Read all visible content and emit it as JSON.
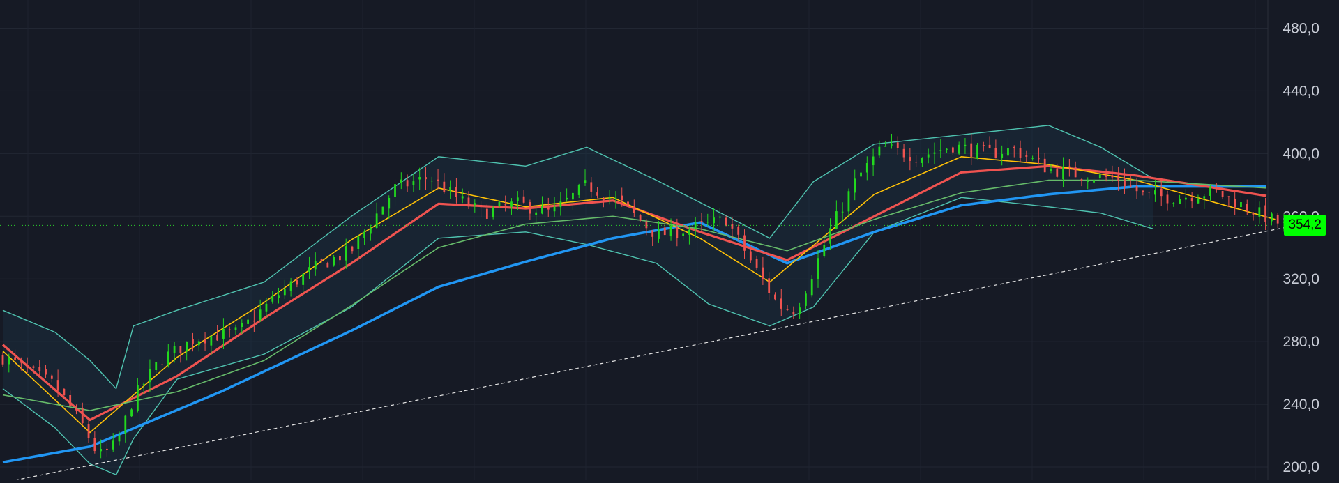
{
  "chart_data": {
    "type": "line",
    "subtype": "candlestick with moving averages and bollinger bands",
    "title": "",
    "xlabel": "",
    "ylabel": "",
    "ylim": [
      192,
      498
    ],
    "y_ticks": [
      200,
      240,
      280,
      320,
      360,
      400,
      440,
      480
    ],
    "y_tick_labels": [
      "200,0",
      "240,0",
      "280,0",
      "320,0",
      "360,0",
      "400,0",
      "440,0",
      "480,0"
    ],
    "grid": true,
    "last_price": 354.2,
    "last_price_label": "354,2",
    "bar_count": 210,
    "price_path": [
      [
        0,
        270
      ],
      [
        12,
        252
      ],
      [
        18,
        228
      ],
      [
        22,
        207
      ],
      [
        26,
        214
      ],
      [
        30,
        244
      ],
      [
        36,
        268
      ],
      [
        44,
        282
      ],
      [
        54,
        286
      ],
      [
        64,
        312
      ],
      [
        72,
        328
      ],
      [
        80,
        338
      ],
      [
        90,
        378
      ],
      [
        98,
        385
      ],
      [
        104,
        372
      ],
      [
        110,
        362
      ],
      [
        118,
        368
      ],
      [
        126,
        362
      ],
      [
        134,
        380
      ],
      [
        142,
        368
      ],
      [
        150,
        348
      ],
      [
        158,
        352
      ],
      [
        166,
        358
      ],
      [
        172,
        330
      ],
      [
        178,
        303
      ],
      [
        182,
        300
      ],
      [
        186,
        325
      ],
      [
        190,
        352
      ],
      [
        196,
        384
      ],
      [
        202,
        404
      ],
      [
        210,
        398
      ],
      [
        218,
        405
      ],
      [
        226,
        400
      ],
      [
        232,
        403
      ],
      [
        240,
        390
      ],
      [
        248,
        386
      ],
      [
        256,
        384
      ],
      [
        262,
        373
      ],
      [
        270,
        372
      ],
      [
        278,
        376
      ],
      [
        288,
        362
      ],
      [
        294,
        354
      ]
    ],
    "trendline": {
      "from": [
        0,
        190
      ],
      "to": [
        300,
        356
      ],
      "style": "dashed",
      "color": "#e6e6e6"
    },
    "series": [
      {
        "color": "#2196f3",
        "style": "thick",
        "values": [
          [
            0,
            203
          ],
          [
            20,
            213
          ],
          [
            50,
            248
          ],
          [
            80,
            287
          ],
          [
            100,
            315
          ],
          [
            120,
            331
          ],
          [
            140,
            346
          ],
          [
            160,
            356
          ],
          [
            180,
            330
          ],
          [
            200,
            350
          ],
          [
            220,
            367
          ],
          [
            240,
            374
          ],
          [
            260,
            379
          ],
          [
            290,
            379
          ]
        ]
      },
      {
        "color": "#ef5350",
        "style": "medium",
        "values": [
          [
            0,
            278
          ],
          [
            20,
            230
          ],
          [
            40,
            258
          ],
          [
            60,
            295
          ],
          [
            80,
            330
          ],
          [
            100,
            368
          ],
          [
            120,
            365
          ],
          [
            140,
            370
          ],
          [
            160,
            350
          ],
          [
            180,
            332
          ],
          [
            200,
            360
          ],
          [
            220,
            388
          ],
          [
            240,
            392
          ],
          [
            260,
            386
          ],
          [
            290,
            373
          ]
        ]
      },
      {
        "color": "#ffc107",
        "style": "thin",
        "values": [
          [
            0,
            274
          ],
          [
            20,
            222
          ],
          [
            40,
            270
          ],
          [
            60,
            305
          ],
          [
            80,
            345
          ],
          [
            100,
            378
          ],
          [
            120,
            366
          ],
          [
            140,
            372
          ],
          [
            160,
            346
          ],
          [
            176,
            318
          ],
          [
            200,
            374
          ],
          [
            220,
            398
          ],
          [
            240,
            393
          ],
          [
            260,
            383
          ],
          [
            292,
            358
          ]
        ]
      },
      {
        "color": "#66bb6a",
        "style": "thin",
        "values": [
          [
            0,
            246
          ],
          [
            20,
            236
          ],
          [
            40,
            248
          ],
          [
            60,
            268
          ],
          [
            80,
            303
          ],
          [
            100,
            340
          ],
          [
            120,
            355
          ],
          [
            140,
            360
          ],
          [
            160,
            352
          ],
          [
            180,
            338
          ],
          [
            200,
            358
          ],
          [
            220,
            375
          ],
          [
            240,
            383
          ],
          [
            260,
            383
          ],
          [
            290,
            378
          ]
        ]
      }
    ],
    "bollinger_bands": {
      "color": "#4fc3b0",
      "upper": [
        [
          0,
          300
        ],
        [
          12,
          286
        ],
        [
          20,
          268
        ],
        [
          26,
          250
        ],
        [
          30,
          290
        ],
        [
          40,
          300
        ],
        [
          60,
          318
        ],
        [
          80,
          360
        ],
        [
          100,
          398
        ],
        [
          120,
          392
        ],
        [
          134,
          404
        ],
        [
          150,
          383
        ],
        [
          162,
          366
        ],
        [
          176,
          346
        ],
        [
          186,
          382
        ],
        [
          200,
          406
        ],
        [
          220,
          412
        ],
        [
          240,
          418
        ],
        [
          252,
          404
        ],
        [
          264,
          384
        ]
      ],
      "lower": [
        [
          0,
          250
        ],
        [
          12,
          225
        ],
        [
          20,
          202
        ],
        [
          26,
          195
        ],
        [
          30,
          218
        ],
        [
          40,
          256
        ],
        [
          60,
          272
        ],
        [
          80,
          302
        ],
        [
          100,
          346
        ],
        [
          120,
          350
        ],
        [
          134,
          342
        ],
        [
          150,
          330
        ],
        [
          162,
          304
        ],
        [
          176,
          290
        ],
        [
          186,
          302
        ],
        [
          200,
          350
        ],
        [
          220,
          372
        ],
        [
          240,
          366
        ],
        [
          252,
          362
        ],
        [
          264,
          352
        ]
      ]
    }
  },
  "price_tag_label": "354,2"
}
